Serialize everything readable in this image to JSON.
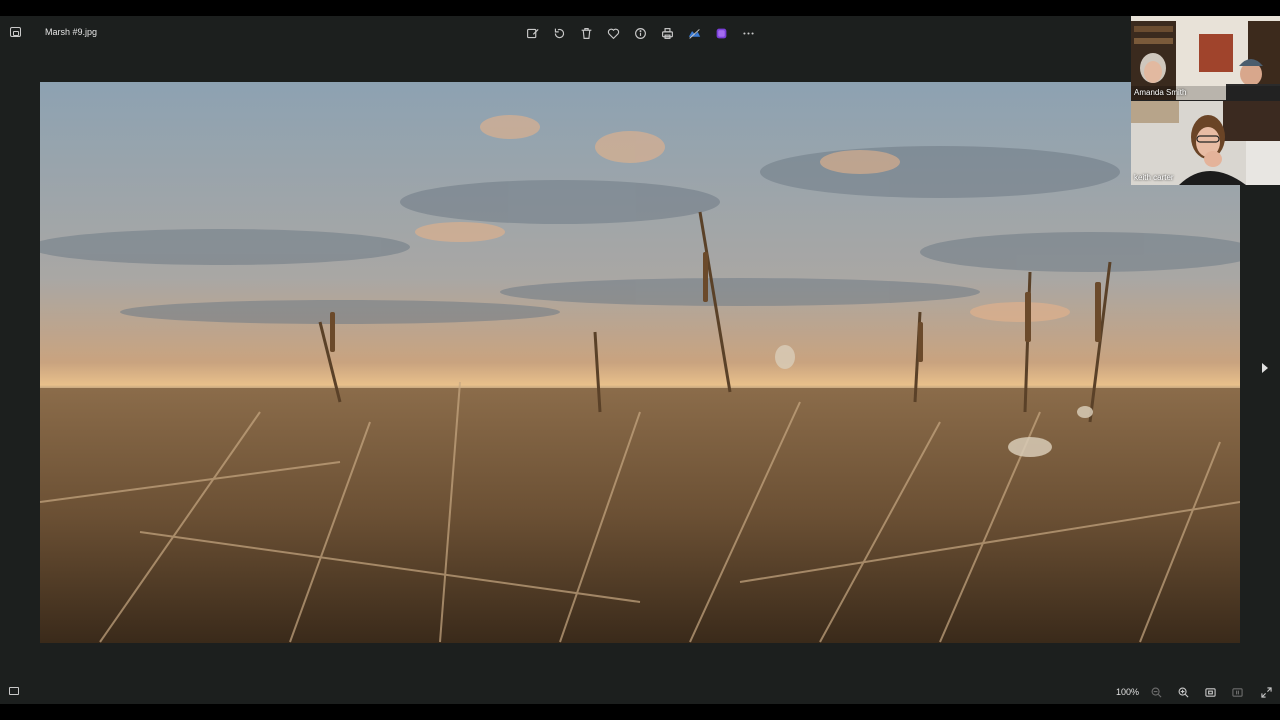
{
  "viewer": {
    "file_name": "Marsh #9.jpg",
    "toolbar": {
      "icons": [
        "edit-icon",
        "rotate-icon",
        "delete-icon",
        "favorite-icon",
        "info-icon",
        "print-icon",
        "onedrive-icon",
        "clipchamp-icon",
        "more-icon"
      ]
    },
    "zoom_level": "100%",
    "colors": {
      "background": "#1c1f1e",
      "frame": "#000000",
      "icon": "#c9c9c9"
    }
  },
  "video_call": {
    "participants": [
      {
        "name": "Amanda Smith"
      },
      {
        "name": "keith carter"
      }
    ]
  }
}
